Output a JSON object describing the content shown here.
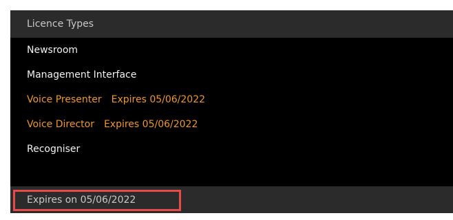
{
  "panel": {
    "header_title": "Licence Types",
    "items": [
      {
        "name": "Newsroom",
        "expiry": "",
        "status": "active"
      },
      {
        "name": "Management Interface",
        "expiry": "",
        "status": "active"
      },
      {
        "name": "Voice Presenter",
        "expiry": "Expires 05/06/2022",
        "status": "expiring"
      },
      {
        "name": "Voice Director",
        "expiry": "Expires 05/06/2022",
        "status": "expiring"
      },
      {
        "name": "Recogniser",
        "expiry": "",
        "status": "active"
      }
    ],
    "footer_text": "Expires on 05/06/2022"
  },
  "colors": {
    "panel_background": "#000000",
    "header_background": "#2b2b2b",
    "item_text": "#f2f2f2",
    "expiring_text": "#f0962a",
    "highlight_border": "#e84a4a"
  }
}
